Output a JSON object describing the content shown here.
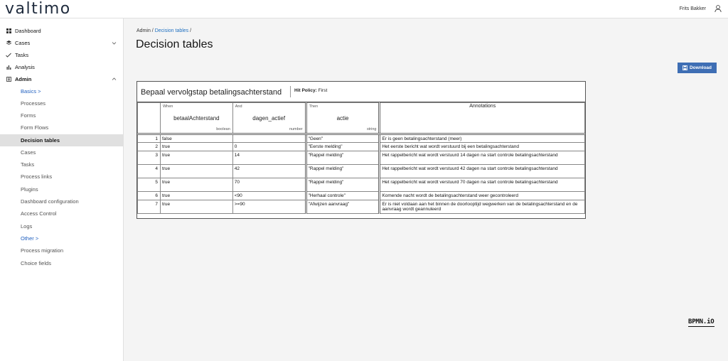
{
  "app": {
    "logo": "valtimo",
    "user_name": "Frits Bakker"
  },
  "sidebar": {
    "items": [
      {
        "label": "Dashboard",
        "icon": "dashboard-icon"
      },
      {
        "label": "Cases",
        "icon": "cases-icon"
      },
      {
        "label": "Tasks",
        "icon": "tasks-icon"
      },
      {
        "label": "Analysis",
        "icon": "analysis-icon"
      },
      {
        "label": "Admin",
        "icon": "admin-icon"
      }
    ],
    "admin_sub": [
      "Basics >",
      "Processes",
      "Forms",
      "Form Flows",
      "Decision tables",
      "Cases",
      "Tasks",
      "Process links",
      "Plugins",
      "Dashboard configuration",
      "Access Control",
      "Logs",
      "Other >",
      "Process migration",
      "Choice fields"
    ]
  },
  "breadcrumb": {
    "root": "Admin",
    "sep": "/",
    "current": "Decision tables",
    "trail_sep": "/"
  },
  "page": {
    "title": "Decision tables",
    "download_label": "Download"
  },
  "dmn": {
    "name": "Bepaal vervolgstap betalingsachterstand",
    "hit_policy_label": "Hit Policy:",
    "hit_policy_value": "First",
    "columns": [
      {
        "label": "When",
        "expr": "betaalAchterstand",
        "type": "boolean"
      },
      {
        "label": "And",
        "expr": "dagen_actief",
        "type": "number"
      },
      {
        "label": "Then",
        "expr": "actie",
        "type": "string"
      },
      {
        "label": "Annotations"
      }
    ],
    "rows": [
      {
        "idx": "1",
        "c1": "false",
        "c2": "",
        "out": "\"Geen\"",
        "ann": "Er is geen betalingsachterstand (meer)"
      },
      {
        "idx": "2",
        "c1": "true",
        "c2": "0",
        "out": "\"Eerste melding\"",
        "ann": "Het eerste bericht wat wordt verstuurd bij een betalingsachterstand"
      },
      {
        "idx": "3",
        "c1": "true",
        "c2": "14",
        "out": "\"Rappel melding\"",
        "ann": "Het rappelbericht wat wordt verstuurd 14 dagen na start controle betalingsachterstand"
      },
      {
        "idx": "4",
        "c1": "true",
        "c2": "42",
        "out": "\"Rappel melding\"",
        "ann": "Het rappelbericht wat wordt verstuurd 42 dagen na start controle betalingsachterstand"
      },
      {
        "idx": "5",
        "c1": "true",
        "c2": "70",
        "out": "\"Rappel melding\"",
        "ann": "Het rappelbericht wat wordt verstuurd 70 dagen na start controle betalingsachterstand"
      },
      {
        "idx": "6",
        "c1": "true",
        "c2": "<90",
        "out": "\"Herhaal controle\"",
        "ann": "Komende nacht wordt de betalingsachterstand weer gecontroleerd"
      },
      {
        "idx": "7",
        "c1": "true",
        "c2": ">=90",
        "out": "\"Afwijzen aanvraag\"",
        "ann": "Er is niet voldaan aan het binnen de doorlooptijd wegwerken van de betalingsachterstand en de aanvraag wordt geannuleerd"
      }
    ]
  },
  "footer": {
    "powered_by": "BPMN.iO"
  }
}
